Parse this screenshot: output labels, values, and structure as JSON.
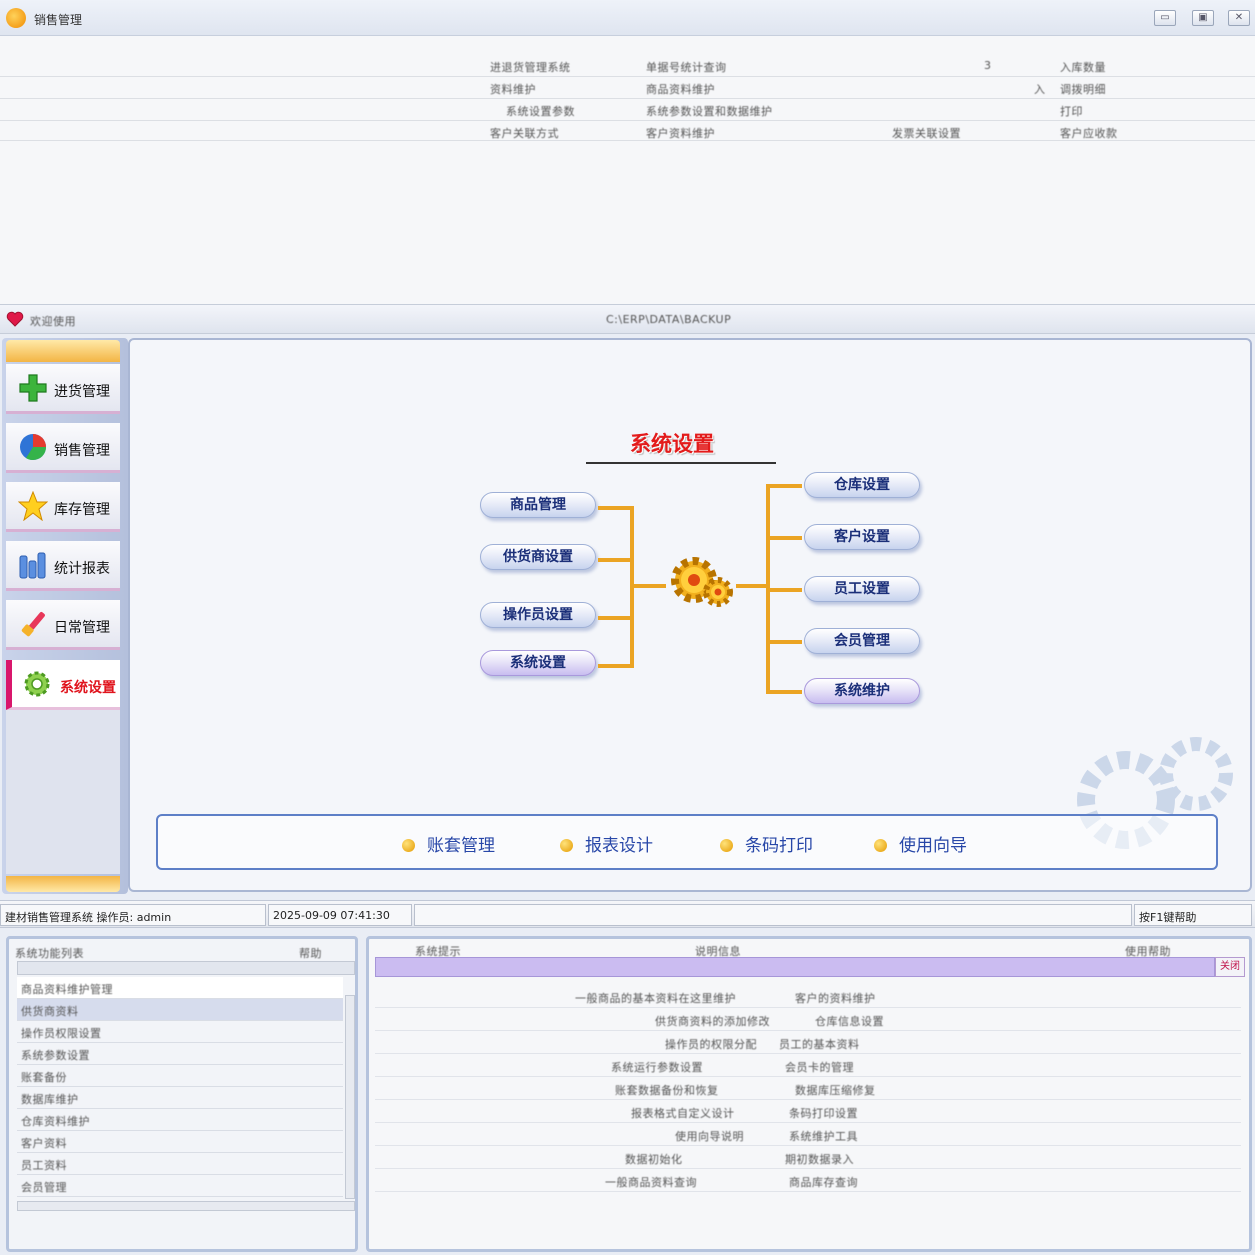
{
  "window": {
    "title": "销售管理",
    "buttons": [
      "▭",
      "▣",
      "✕"
    ]
  },
  "upper": {
    "rows": [
      [
        "进退货管理系统",
        "单据号统计查询",
        "3",
        "入库数量"
      ],
      [
        "资料维护",
        "商品资料维护",
        "入",
        "调拨明细"
      ],
      [
        "系统设置参数",
        "系统参数设置和数据维护",
        "",
        "打印"
      ],
      [
        "客户关联方式",
        "客户资料维护",
        "发票关联设置",
        "客户应收款"
      ]
    ]
  },
  "ribbon": {
    "left": "欢迎使用",
    "center": "C:\\ERP\\DATA\\BACKUP"
  },
  "sidebar": {
    "items": [
      {
        "label": "进货管理",
        "icon": "plus-icon"
      },
      {
        "label": "销售管理",
        "icon": "pie-chart-icon"
      },
      {
        "label": "库存管理",
        "icon": "star-icon"
      },
      {
        "label": "统计报表",
        "icon": "bar-chart-icon"
      },
      {
        "label": "日常管理",
        "icon": "brush-icon"
      },
      {
        "label": "系统设置",
        "icon": "gear-icon"
      }
    ],
    "active_index": 5
  },
  "main": {
    "title": "系统设置",
    "left_buttons": [
      "商品管理",
      "供货商设置",
      "操作员设置",
      "系统设置"
    ],
    "right_buttons": [
      "仓库设置",
      "客户设置",
      "员工设置",
      "会员管理",
      "系统维护"
    ],
    "links": [
      "账套管理",
      "报表设计",
      "条码打印",
      "使用向导"
    ]
  },
  "statusbar": {
    "system": "建材销售管理系统 操作员: admin",
    "datetime": "2025-09-09 07:41:30",
    "right": "按F1键帮助"
  },
  "bottom_left": {
    "header_left": "系统功能列表",
    "header_right": "帮助",
    "rows": [
      "商品资料维护管理",
      "供货商资料",
      "操作员权限设置",
      "系统参数设置",
      "账套备份",
      "数据库维护",
      "仓库资料维护",
      "客户资料",
      "员工资料",
      "会员管理"
    ]
  },
  "bottom_right": {
    "header_left": "系统提示",
    "header_center": "说明信息",
    "header_right": "使用帮助",
    "button": "关闭",
    "rows": [
      [
        "一般商品的基本资料在这里维护",
        "客户的资料维护"
      ],
      [
        "供货商资料的添加修改",
        "仓库信息设置"
      ],
      [
        "操作员的权限分配",
        "员工的基本资料"
      ],
      [
        "系统运行参数设置",
        "会员卡的管理"
      ],
      [
        "账套数据备份和恢复",
        "数据库压缩修复"
      ],
      [
        "报表格式自定义设计",
        "条码打印设置"
      ],
      [
        "使用向导说明",
        "系统维护工具"
      ],
      [
        "数据初始化",
        "期初数据录入"
      ],
      [
        "一般商品资料查询",
        "商品库存查询"
      ]
    ]
  },
  "colors": {
    "accent_orange": "#eba423",
    "title_red": "#e31b1b",
    "pill_text": "#1b2f79",
    "link_blue": "#2847a8"
  }
}
